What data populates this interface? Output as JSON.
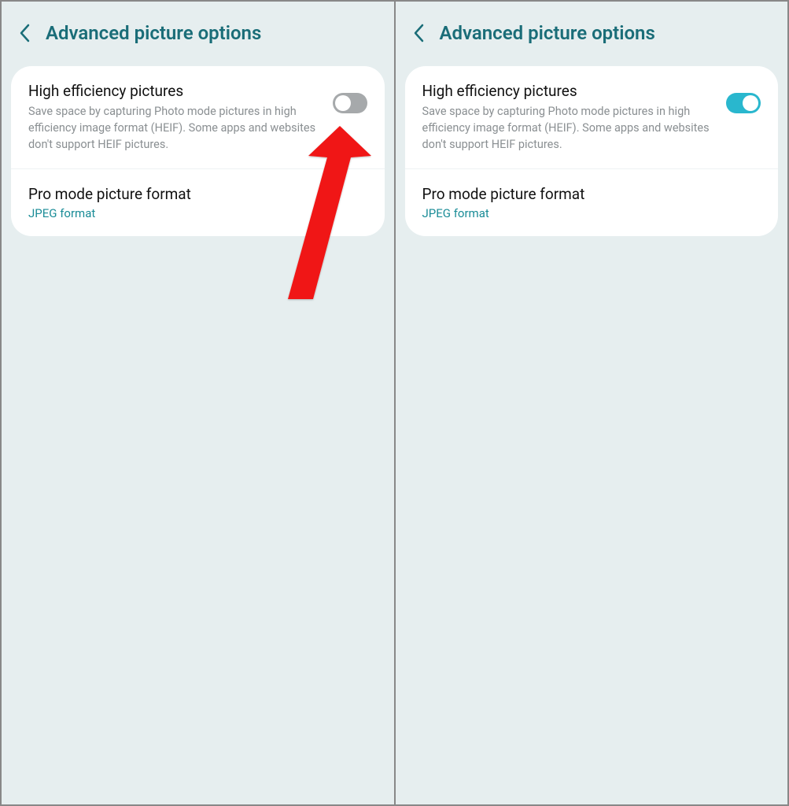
{
  "left": {
    "title": "Advanced picture options",
    "heif": {
      "title": "High efficiency pictures",
      "desc": "Save space by capturing Photo mode pictures in high efficiency image format (HEIF). Some apps and websites don't support HEIF pictures.",
      "on": false
    },
    "pro": {
      "title": "Pro mode picture format",
      "value": "JPEG format"
    }
  },
  "right": {
    "title": "Advanced picture options",
    "heif": {
      "title": "High efficiency pictures",
      "desc": "Save space by capturing Photo mode pictures in high efficiency image format (HEIF). Some apps and websites don't support HEIF pictures.",
      "on": true
    },
    "pro": {
      "title": "Pro mode picture format",
      "value": "JPEG format"
    }
  },
  "colors": {
    "accent": "#1a8c97",
    "toggleOn": "#29b7ce",
    "toggleOff": "#a6a9ab",
    "arrow": "#f01414"
  }
}
